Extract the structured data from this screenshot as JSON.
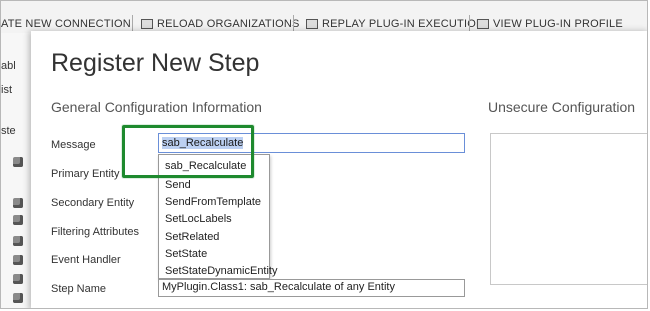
{
  "toolbar": {
    "new_connection": "ATE NEW CONNECTION",
    "reload": "RELOAD ORGANIZATIONS",
    "replay": "REPLAY PLUG-IN EXECUTION",
    "profile": "VIEW PLUG-IN PROFILE"
  },
  "left_fragments": {
    "a": "abl",
    "b": "ist",
    "c": "ste"
  },
  "dialog": {
    "title": "Register New Step",
    "general_heading": "General Configuration Information",
    "unsecure_heading": "Unsecure  Configuration",
    "labels": {
      "message": "Message",
      "primary_entity": "Primary Entity",
      "secondary_entity": "Secondary Entity",
      "filtering_attributes": "Filtering Attributes",
      "event_handler": "Event Handler",
      "step_name": "Step Name"
    },
    "message_value": "sab_Recalculate",
    "dropdown_items": [
      "sab_Recalculate",
      "Send",
      "SendFromTemplate",
      "SetLocLabels",
      "SetRelated",
      "SetState",
      "SetStateDynamicEntity"
    ],
    "step_name_value": "MyPlugin.Class1: sab_Recalculate of any Entity"
  },
  "colors": {
    "highlight": "#1e8a2e",
    "input_focus_border": "#6a8fd8",
    "selection": "#bcd0f2"
  }
}
